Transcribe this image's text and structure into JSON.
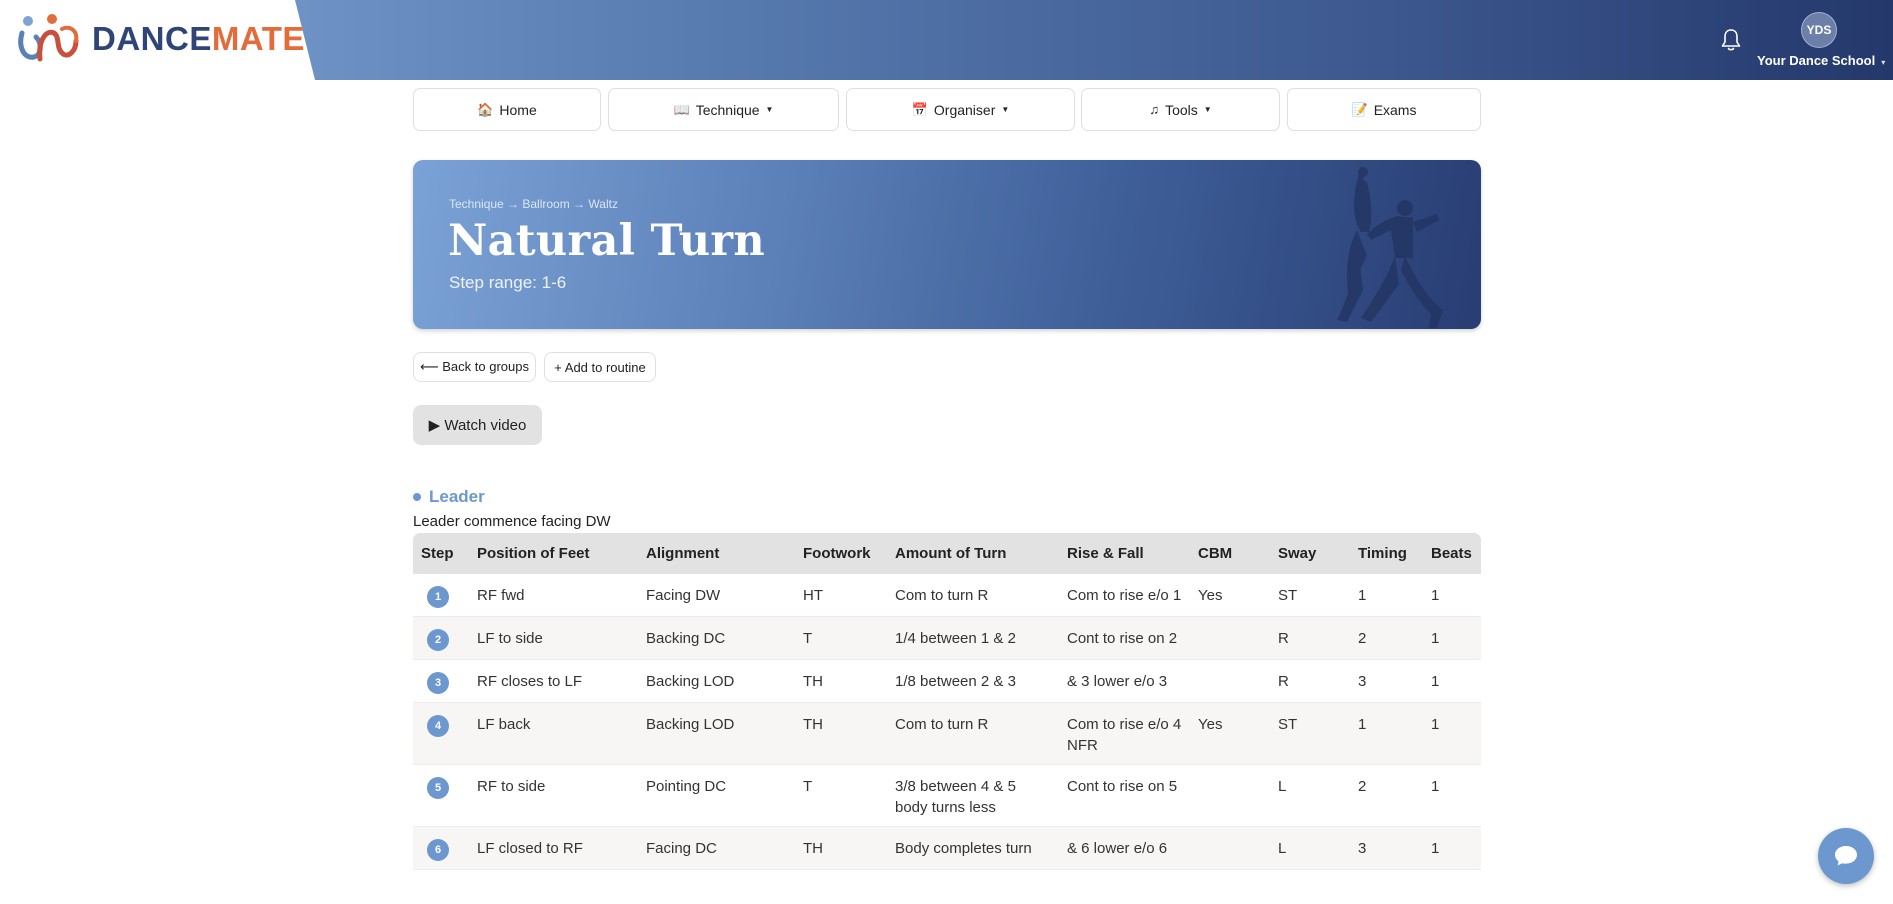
{
  "brand": {
    "name_part1": "DANCE",
    "name_part2": "MATE",
    "colors": {
      "primary": "#2f4478",
      "accent": "#e26c3a",
      "blue": "#6c97cf"
    }
  },
  "header": {
    "notification_icon": "bell-icon",
    "avatar_initials": "YDS",
    "school_name": "Your Dance School"
  },
  "nav": [
    {
      "label": "Home",
      "icon": "home-icon",
      "dropdown": false
    },
    {
      "label": "Technique",
      "icon": "book-icon",
      "dropdown": true
    },
    {
      "label": "Organiser",
      "icon": "calendar-icon",
      "dropdown": true
    },
    {
      "label": "Tools",
      "icon": "music-note-icon",
      "dropdown": true
    },
    {
      "label": "Exams",
      "icon": "memo-icon",
      "dropdown": false
    }
  ],
  "hero": {
    "breadcrumb": "Technique → Ballroom → Waltz",
    "title": "Natural Turn",
    "subtitle": "Step range: 1-6"
  },
  "actions": {
    "back": "⟵ Back to groups",
    "add": "+ Add to routine",
    "watch": "▶ Watch video"
  },
  "section": {
    "heading": "Leader",
    "note": "Leader commence facing DW"
  },
  "table": {
    "columns": [
      "Step",
      "Position of Feet",
      "Alignment",
      "Footwork",
      "Amount of Turn",
      "Rise & Fall",
      "CBM",
      "Sway",
      "Timing",
      "Beats"
    ],
    "rows": [
      [
        "1",
        "RF fwd",
        "Facing DW",
        "HT",
        "Com to turn R",
        "Com to rise e/o 1",
        "Yes",
        "ST",
        "1",
        "1"
      ],
      [
        "2",
        "LF to side",
        "Backing DC",
        "T",
        "1/4 between 1 & 2",
        "Cont to rise on 2",
        "",
        "R",
        "2",
        "1"
      ],
      [
        "3",
        "RF closes to LF",
        "Backing LOD",
        "TH",
        "1/8 between 2 & 3",
        "& 3 lower e/o 3",
        "",
        "R",
        "3",
        "1"
      ],
      [
        "4",
        "LF back",
        "Backing LOD",
        "TH",
        "Com to turn R",
        "Com to rise e/o 4 NFR",
        "Yes",
        "ST",
        "1",
        "1"
      ],
      [
        "5",
        "RF to side",
        "Pointing DC",
        "T",
        "3/8 between 4 & 5 body turns less",
        "Cont to rise on 5",
        "",
        "L",
        "2",
        "1"
      ],
      [
        "6",
        "LF closed to RF",
        "Facing DC",
        "TH",
        "Body completes turn",
        "& 6 lower e/o 6",
        "",
        "L",
        "3",
        "1"
      ]
    ]
  },
  "chat": {
    "icon": "chat-bubble-icon"
  }
}
